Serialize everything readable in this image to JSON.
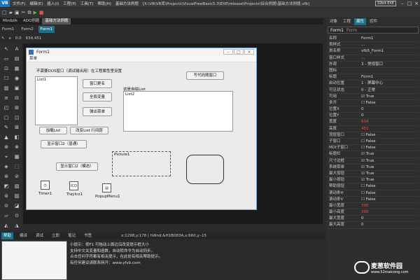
{
  "titlebar": {
    "logo": "VB",
    "menu": [
      "文件(F)",
      "编辑(E)",
      "插入(I)",
      "工程(P)",
      "工具(T)",
      "帮助(H)",
      "基础方法例题"
    ],
    "path": "[X:\\VB\\VB库\\Projects\\VisualFreeBasic5.3\\EXE\\release\\Projects\\综合例题\\基础方法例题.vfb]",
    "badge": "32bit EXE"
  },
  "doctabs": [
    "Minibilk",
    "ADO例题",
    "基础方法例题"
  ],
  "subtabs": [
    "Form1",
    "Form2",
    "Form1"
  ],
  "coords": {
    "label": "x",
    "v1": "0.0",
    "v2": "634,451"
  },
  "toolbox": [
    "↖",
    "A",
    "▭",
    "▤",
    "⊡",
    "▦",
    "☐",
    "◉",
    "▥",
    "▣",
    "≡",
    "⊟",
    "◰",
    "⊞",
    "▢",
    "◫",
    "✎",
    "⊠",
    "▲",
    "◧",
    "⊕",
    "⊗",
    "⌖",
    "▩",
    "◈",
    "⬚",
    "⊛",
    "⊘",
    "◩",
    "▧",
    "⊜",
    "▨",
    "⊝",
    "◪",
    "▱",
    "⊙",
    "◭",
    "◮"
  ],
  "form": {
    "title": "Form1",
    "menu": "菜单",
    "caption_top": "不需要DOS窗口（调试输出用）在工程属性里设置",
    "list1": "List1",
    "btn_rename": "窗口更名",
    "btn_global": "全局变量",
    "btn_popup": "弹出菜单",
    "btn_write": "写代码随窗口",
    "label_here": "这是自绘List",
    "list2": "List2",
    "btn_add": "加载List",
    "btn_timer": "改变List 行间距",
    "btn_show2": "显示窗口2（普通）",
    "picture": "Picture1",
    "btn_modal": "显示窗口2（模态）",
    "timer": "Timer1",
    "tray": "TrayIco1",
    "tray_icon": "ICO",
    "popup": "PopupMenu1"
  },
  "rtabs": [
    "对象",
    "工程",
    "属性",
    "控件"
  ],
  "objsel": {
    "name": "Form1",
    "type": "Form"
  },
  "props": [
    [
      "名称",
      "Form1",
      ""
    ],
    [
      "类样式",
      "...",
      ""
    ],
    [
      "类名称",
      "vfb5_Form1",
      ""
    ],
    [
      "窗口样式",
      "...",
      ""
    ],
    [
      "外观",
      "3 - 常规窗口",
      ""
    ],
    [
      "图标",
      "",
      ""
    ],
    [
      "标题",
      "Form1",
      ""
    ],
    [
      "启动位置",
      "1 - 屏幕中心",
      ""
    ],
    [
      "可见状态",
      "0 - 正常",
      ""
    ],
    [
      "可用",
      "☑ True",
      ""
    ],
    [
      "多开",
      "☐ False",
      ""
    ],
    [
      "位置X",
      "0",
      ""
    ],
    [
      "位置Y",
      "0",
      ""
    ],
    [
      "宽度",
      "634",
      "red"
    ],
    [
      "高度",
      "451",
      "red"
    ],
    [
      "顶层窗口",
      "☐ False",
      ""
    ],
    [
      "子窗口",
      "☐ False",
      ""
    ],
    [
      "MDI子窗口",
      "☐ False",
      ""
    ],
    [
      "标题栏",
      "☑ True",
      ""
    ],
    [
      "尺寸边框",
      "☑ True",
      ""
    ],
    [
      "系统菜单",
      "☑ True",
      ""
    ],
    [
      "最大按钮",
      "☑ True",
      ""
    ],
    [
      "最小按钮",
      "☑ True",
      ""
    ],
    [
      "帮助按钮",
      "☐ False",
      ""
    ],
    [
      "滚动条H",
      "☐ False",
      ""
    ],
    [
      "滚动条V",
      "☐ False",
      ""
    ],
    [
      "最小宽度",
      "300",
      "red"
    ],
    [
      "最小高度",
      "300",
      "red"
    ],
    [
      "最大宽度",
      "0",
      ""
    ],
    [
      "最大高度",
      "0",
      ""
    ]
  ],
  "btabs": [
    "帮助",
    "编译",
    "调试",
    "立即",
    "笔记",
    "书签"
  ],
  "cursor_info": "x:1298,y:178 | hWnd:&H1B083A,x:660,y:-15",
  "help": [
    "小提示：按F1 可拖动上面边沿改变提示框大小",
    "支持中文关变量和函数，自动转命令为自动同步。",
    "点击任何字符都有相关提示，在此处有相关帮助提示。",
    "有任何建议请联系网开：www.yfvb.com"
  ],
  "watermark": {
    "t1": "麦葱软件园",
    "t2": "www.52maicong.com"
  }
}
